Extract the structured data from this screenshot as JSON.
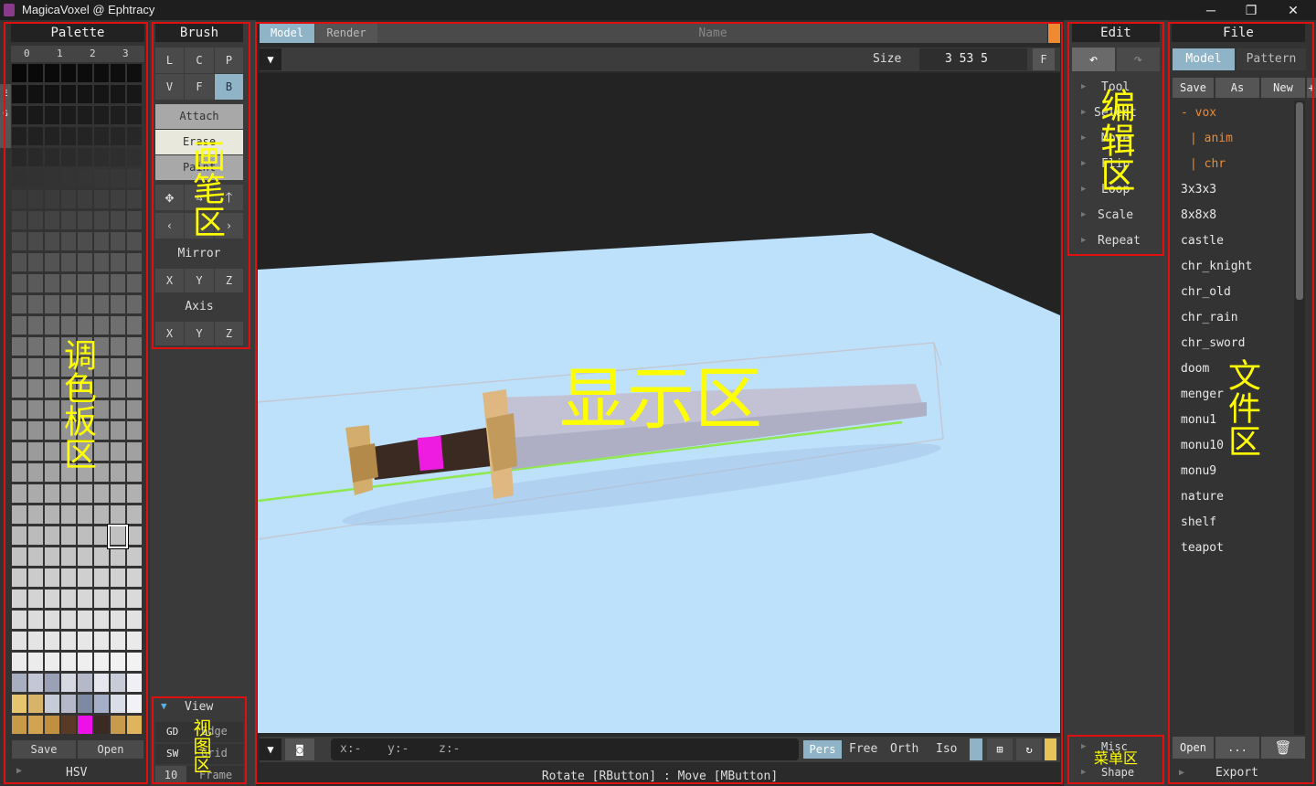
{
  "window": {
    "title": "MagicaVoxel @ Ephtracy",
    "min": "─",
    "max": "❐",
    "close": "✕"
  },
  "palette": {
    "header": "Palette",
    "tabs": [
      "0",
      "1",
      "2",
      "3"
    ],
    "side_tabs": [
      "E",
      "G"
    ],
    "save_label": "Save",
    "open_label": "Open",
    "hsv_label": "HSV",
    "annotation": "调色板区"
  },
  "brush": {
    "header": "Brush",
    "row1": [
      "L",
      "C",
      "P"
    ],
    "row2": [
      "V",
      "F",
      "B"
    ],
    "modes": [
      "Attach",
      "Erase",
      "Paint"
    ],
    "mirror_label": "Mirror",
    "mirror_axes": [
      "X",
      "Y",
      "Z"
    ],
    "axis_label": "Axis",
    "axis_axes": [
      "X",
      "Y",
      "Z"
    ],
    "annotation": "画笔区"
  },
  "view": {
    "header": "View",
    "rows": [
      {
        "key": "GD",
        "label": "Edge"
      },
      {
        "key": "SW",
        "label": "Grid"
      },
      {
        "key": "10",
        "label": "Frame"
      }
    ],
    "annotation": "视图区"
  },
  "viewport": {
    "tabs": [
      "Model",
      "Render"
    ],
    "name_placeholder": "Name",
    "size_label": "Size",
    "size_value": "3 53 5",
    "f_button": "F",
    "annotation": "显示区",
    "coords": {
      "x": "x:-",
      "y": "y:-",
      "z": "z:-"
    },
    "projections": [
      "Pers",
      "Free",
      "Orth",
      "Iso"
    ],
    "status": "Rotate [RButton] : Move [MButton]"
  },
  "edit": {
    "header": "Edit",
    "items": [
      "Tool",
      "Select",
      "Move",
      "Flip",
      "Loop",
      "Scale",
      "Repeat"
    ],
    "annotation": "编辑区",
    "misc": "Misc",
    "shape": "Shape",
    "menu_annotation": "菜单区"
  },
  "file": {
    "header": "File",
    "tabs": [
      "Model",
      "Pattern"
    ],
    "actions": [
      "Save",
      "As",
      "New"
    ],
    "tree": [
      {
        "label": "- vox",
        "color": "#f08a30"
      },
      {
        "label": "| anim",
        "color": "#f08a30"
      },
      {
        "label": "| chr",
        "color": "#f08a30"
      },
      {
        "label": "3x3x3",
        "color": "#e8e8e8"
      },
      {
        "label": "8x8x8",
        "color": "#e8e8e8"
      },
      {
        "label": "castle",
        "color": "#e8e8e8"
      },
      {
        "label": "chr_knight",
        "color": "#e8e8e8"
      },
      {
        "label": "chr_old",
        "color": "#e8e8e8"
      },
      {
        "label": "chr_rain",
        "color": "#e8e8e8"
      },
      {
        "label": "chr_sword",
        "color": "#e8e8e8"
      },
      {
        "label": "doom",
        "color": "#e8e8e8"
      },
      {
        "label": "menger",
        "color": "#e8e8e8"
      },
      {
        "label": "monu1",
        "color": "#e8e8e8"
      },
      {
        "label": "monu10",
        "color": "#e8e8e8"
      },
      {
        "label": "monu9",
        "color": "#e8e8e8"
      },
      {
        "label": "nature",
        "color": "#e8e8e8"
      },
      {
        "label": "shelf",
        "color": "#e8e8e8"
      },
      {
        "label": "teapot",
        "color": "#e8e8e8"
      }
    ],
    "open_label": "Open",
    "more_label": "...",
    "export_label": "Export",
    "annotation": "文件区"
  },
  "colors": {
    "accent": "#8fb4c8",
    "annotation": "#ffff00",
    "highlight_box": "#e01010",
    "orange": "#f08a30"
  }
}
